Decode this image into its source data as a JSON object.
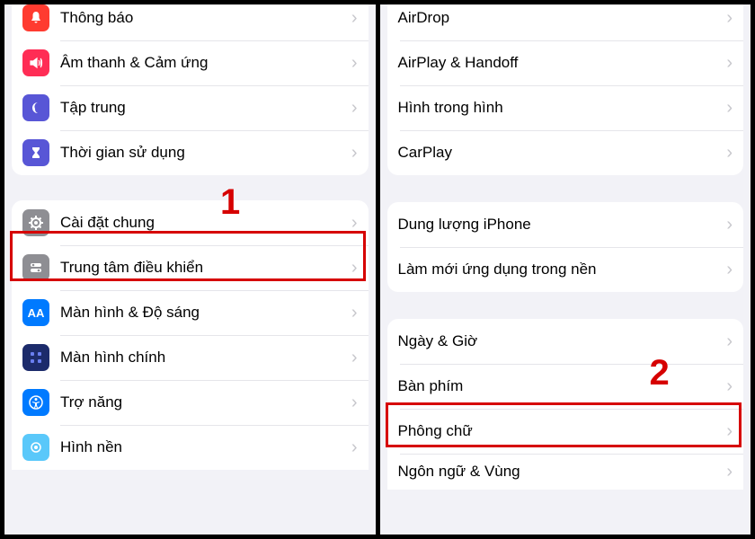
{
  "left": {
    "group1": [
      {
        "label": "Thông báo",
        "icon": "bell-icon",
        "color": "ic-red"
      },
      {
        "label": "Âm thanh & Cảm ứng",
        "icon": "speaker-icon",
        "color": "ic-pink"
      },
      {
        "label": "Tập trung",
        "icon": "moon-icon",
        "color": "ic-indigo"
      },
      {
        "label": "Thời gian sử dụng",
        "icon": "hourglass-icon",
        "color": "ic-indigo"
      }
    ],
    "group2": [
      {
        "label": "Cài đặt chung",
        "icon": "gear-icon",
        "color": "ic-gray"
      },
      {
        "label": "Trung tâm điều khiển",
        "icon": "switches-icon",
        "color": "ic-gray"
      },
      {
        "label": "Màn hình & Độ sáng",
        "icon": "text-size-icon",
        "color": "ic-blue"
      },
      {
        "label": "Màn hình chính",
        "icon": "home-grid-icon",
        "color": "ic-darkblue"
      },
      {
        "label": "Trợ năng",
        "icon": "accessibility-icon",
        "color": "ic-blue"
      },
      {
        "label": "Hình nền",
        "icon": "wallpaper-icon",
        "color": "ic-teal"
      }
    ]
  },
  "right": {
    "group1": [
      {
        "label": "AirDrop"
      },
      {
        "label": "AirPlay & Handoff"
      },
      {
        "label": "Hình trong hình"
      },
      {
        "label": "CarPlay"
      }
    ],
    "group2": [
      {
        "label": "Dung lượng iPhone"
      },
      {
        "label": "Làm mới ứng dụng trong nền"
      }
    ],
    "group3": [
      {
        "label": "Ngày & Giờ"
      },
      {
        "label": "Bàn phím"
      },
      {
        "label": "Phông chữ"
      },
      {
        "label": "Ngôn ngữ & Vùng"
      }
    ]
  },
  "annotations": {
    "num1": "1",
    "num2": "2"
  }
}
